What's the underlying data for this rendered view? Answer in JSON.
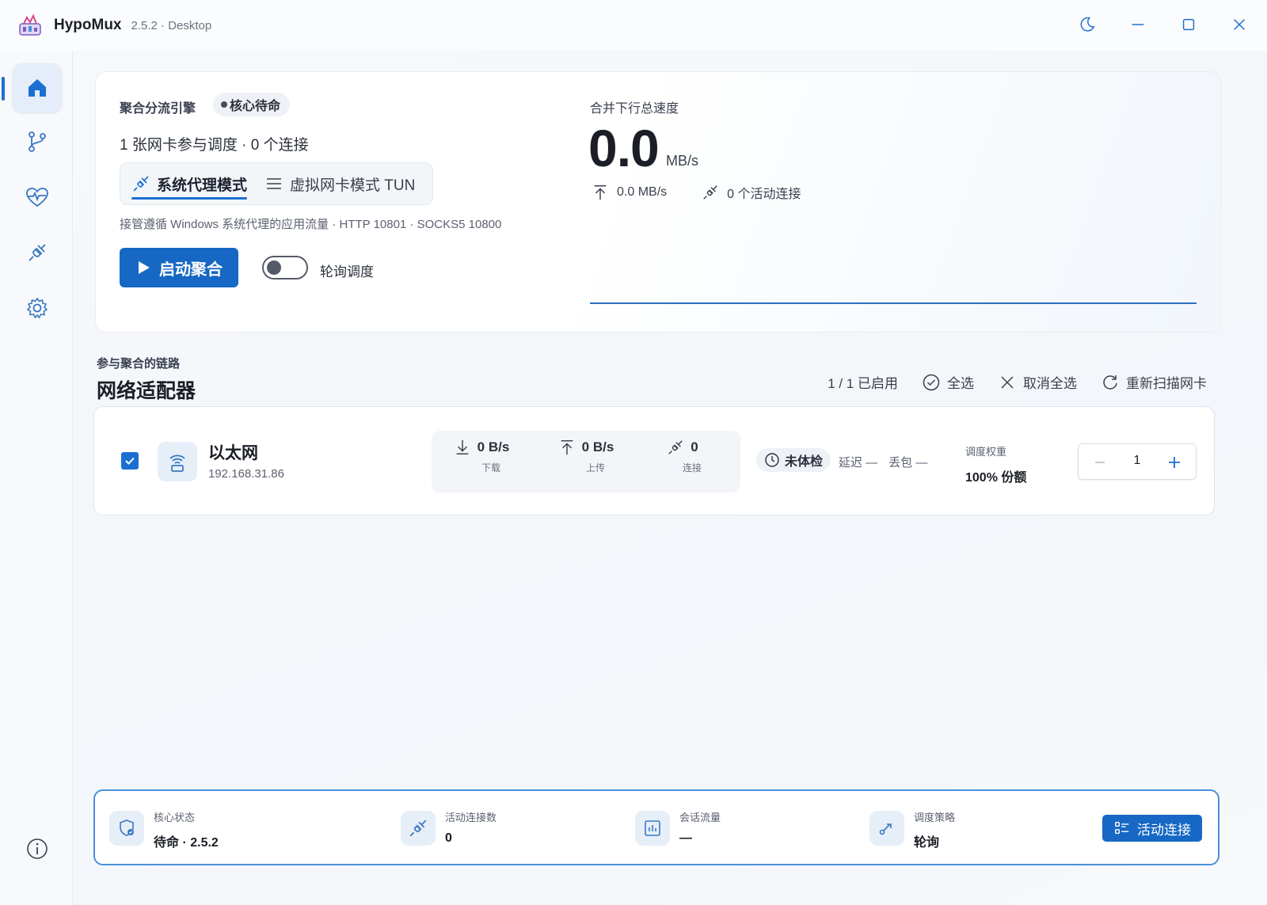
{
  "app": {
    "name": "HypoMux",
    "version": "2.5.2 · Desktop"
  },
  "engine": {
    "label": "聚合分流引擎",
    "status": "核心待命",
    "summary": "1 张网卡参与调度 · 0 个连接",
    "modes": [
      {
        "label": "系统代理模式",
        "active": true
      },
      {
        "label": "虚拟网卡模式 TUN",
        "active": false
      }
    ],
    "mode_desc": "接管遵循 Windows 系统代理的应用流量 · HTTP 10801 · SOCKS5 10800",
    "start_label": "启动聚合",
    "toggle_label": "轮询调度",
    "toggle_on": false
  },
  "speed": {
    "label": "合并下行总速度",
    "value": "0.0",
    "unit": "MB/s",
    "upload": "0.0 MB/s",
    "active_conns": "0 个活动连接"
  },
  "adapters": {
    "subtitle": "参与聚合的链路",
    "title": "网络适配器",
    "enabled_count": "1 / 1 已启用",
    "select_all": "全选",
    "deselect_all": "取消全选",
    "rescan": "重新扫描网卡",
    "items": [
      {
        "checked": true,
        "name": "以太网",
        "ip": "192.168.31.86",
        "download": "0 B/s",
        "download_label": "下载",
        "upload": "0 B/s",
        "upload_label": "上传",
        "connections": "0",
        "connections_label": "连接",
        "health": "未体检",
        "latency": "延迟 —",
        "loss": "丢包 —",
        "weight_label": "调度权重",
        "weight_share": "100% 份额",
        "weight_value": "1"
      }
    ]
  },
  "footer": {
    "core_label": "核心状态",
    "core_value": "待命 · 2.5.2",
    "conns_label": "活动连接数",
    "conns_value": "0",
    "traffic_label": "会话流量",
    "traffic_value": "—",
    "strategy_label": "调度策略",
    "strategy_value": "轮询",
    "button_label": "活动连接"
  },
  "colors": {
    "accent": "#1a6fd1",
    "primary_button": "#1668c4",
    "icon_tint": "#3a78c2"
  }
}
